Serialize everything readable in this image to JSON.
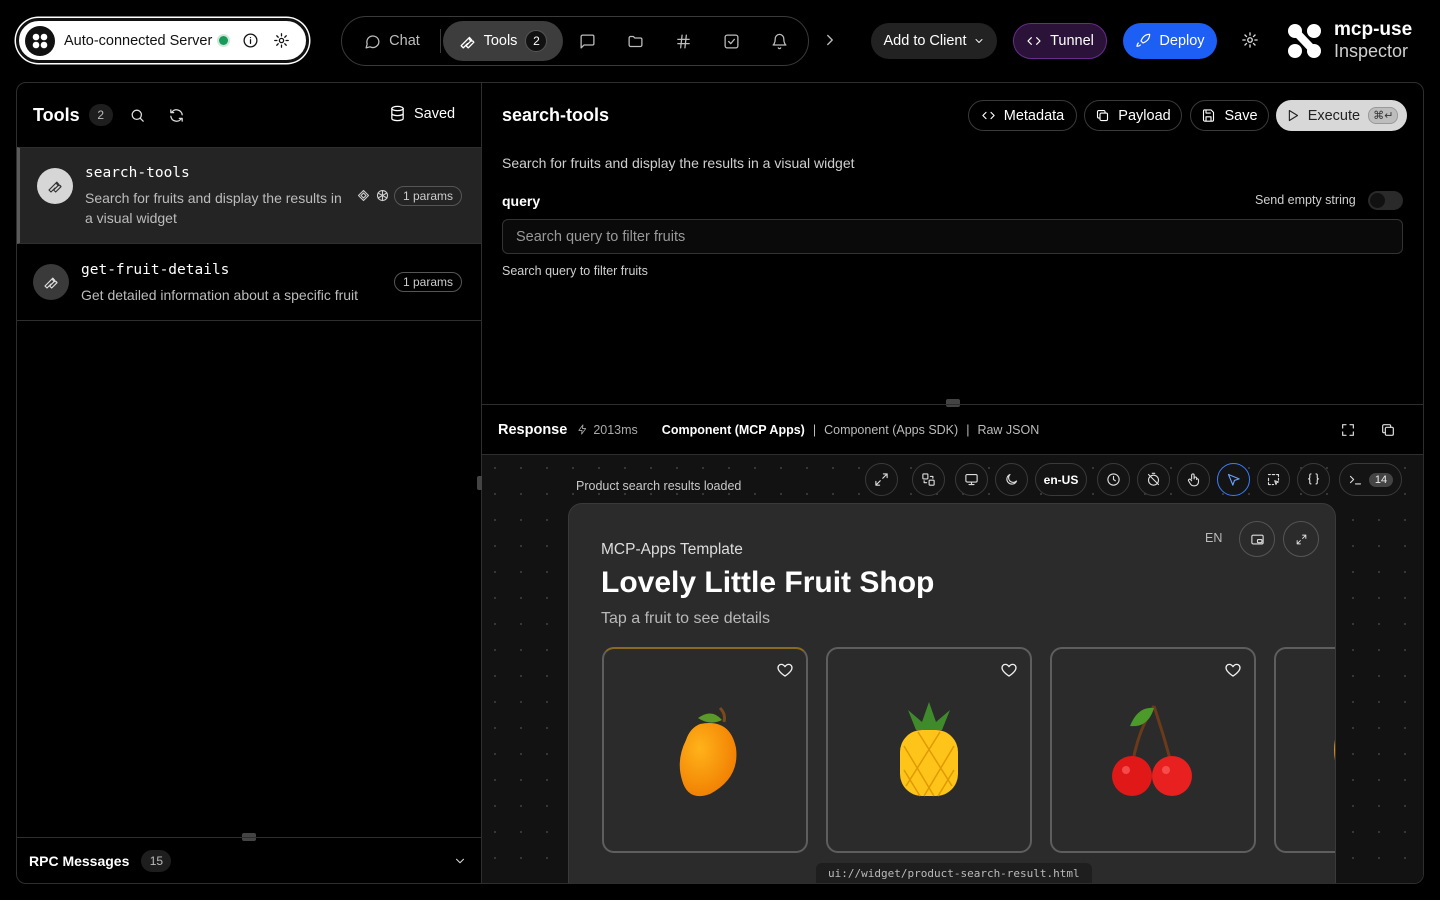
{
  "server": {
    "name": "Auto-connected Server",
    "status_color": "#1a9a5a"
  },
  "nav": {
    "tabs": [
      {
        "label": "Chat",
        "icon": "message-circle-icon"
      },
      {
        "label": "Tools",
        "icon": "wrench-icon",
        "badge": "2",
        "active": true
      }
    ],
    "icons": [
      "message-square-icon",
      "folder-icon",
      "hash-icon",
      "check-square-icon",
      "bell-icon"
    ]
  },
  "actions": {
    "add_client": "Add to Client",
    "tunnel": "Tunnel",
    "deploy": "Deploy"
  },
  "brand": {
    "line1": "mcp-use",
    "line2": "Inspector"
  },
  "tools_panel": {
    "title": "Tools",
    "count": "2",
    "saved_label": "Saved",
    "items": [
      {
        "name": "search-tools",
        "description": "Search for fruits and display the results in a visual widget",
        "params": "1 params",
        "selected": true
      },
      {
        "name": "get-fruit-details",
        "description": "Get detailed information about a specific fruit",
        "params": "1 params"
      }
    ]
  },
  "rpc": {
    "title": "RPC Messages",
    "count": "15"
  },
  "detail": {
    "title": "search-tools",
    "metadata_label": "Metadata",
    "payload_label": "Payload",
    "save_label": "Save",
    "execute_label": "Execute",
    "execute_shortcut": "⌘↵",
    "description": "Search for fruits and display the results in a visual widget",
    "param_name": "query",
    "send_empty_label": "Send empty string",
    "input_placeholder": "Search query to filter fruits",
    "param_help": "Search query to filter fruits"
  },
  "response": {
    "title": "Response",
    "time": "2013ms",
    "tabs": [
      "Component (MCP Apps)",
      "Component (Apps SDK)",
      "Raw JSON"
    ],
    "active_tab": "Component (MCP Apps)",
    "status": "Product search results loaded",
    "locale": "en-US",
    "console_count": "14"
  },
  "widget": {
    "subtitle": "MCP-Apps Template",
    "title": "Lovely Little Fruit Shop",
    "hint": "Tap a fruit to see details",
    "lang": "EN",
    "fruits": [
      "mango",
      "pineapple",
      "cherry"
    ],
    "uri": "ui://widget/product-search-result.html"
  }
}
